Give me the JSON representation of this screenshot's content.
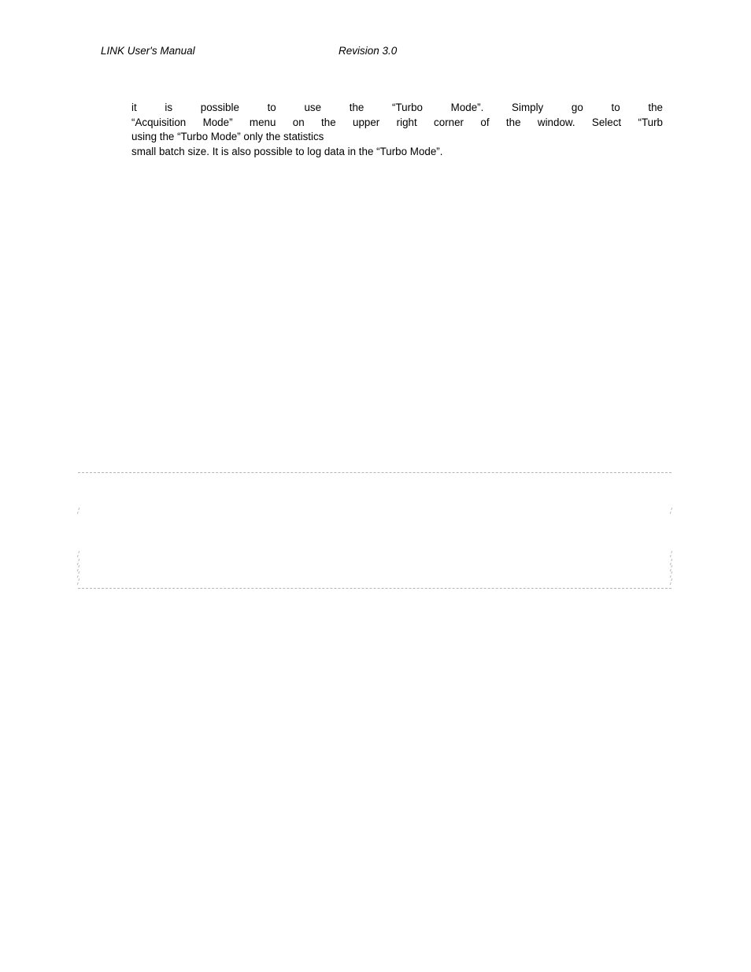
{
  "document": {
    "page_background": "#ffffff",
    "text_color": "#000000"
  },
  "header": {
    "title": "LINK User's Manual",
    "revision": "Revision 3.0"
  },
  "body": {
    "lines": [
      "it is possible to use the “Turbo Mode”. Simply go to the",
      "“Acquisition Mode” menu on the upper right corner of the window. Select “Turb",
      "using the “Turbo Mode” only the statistics",
      "small batch size. It is also possible to log data in the “Turbo Mode”."
    ]
  },
  "figure_placeholder": {
    "border_color": "#7a7a7a",
    "tick_offsets_left": [
      45,
      100,
      110,
      118,
      126,
      135
    ],
    "tick_offsets_right": [
      45,
      100,
      110,
      118,
      126,
      135
    ]
  }
}
